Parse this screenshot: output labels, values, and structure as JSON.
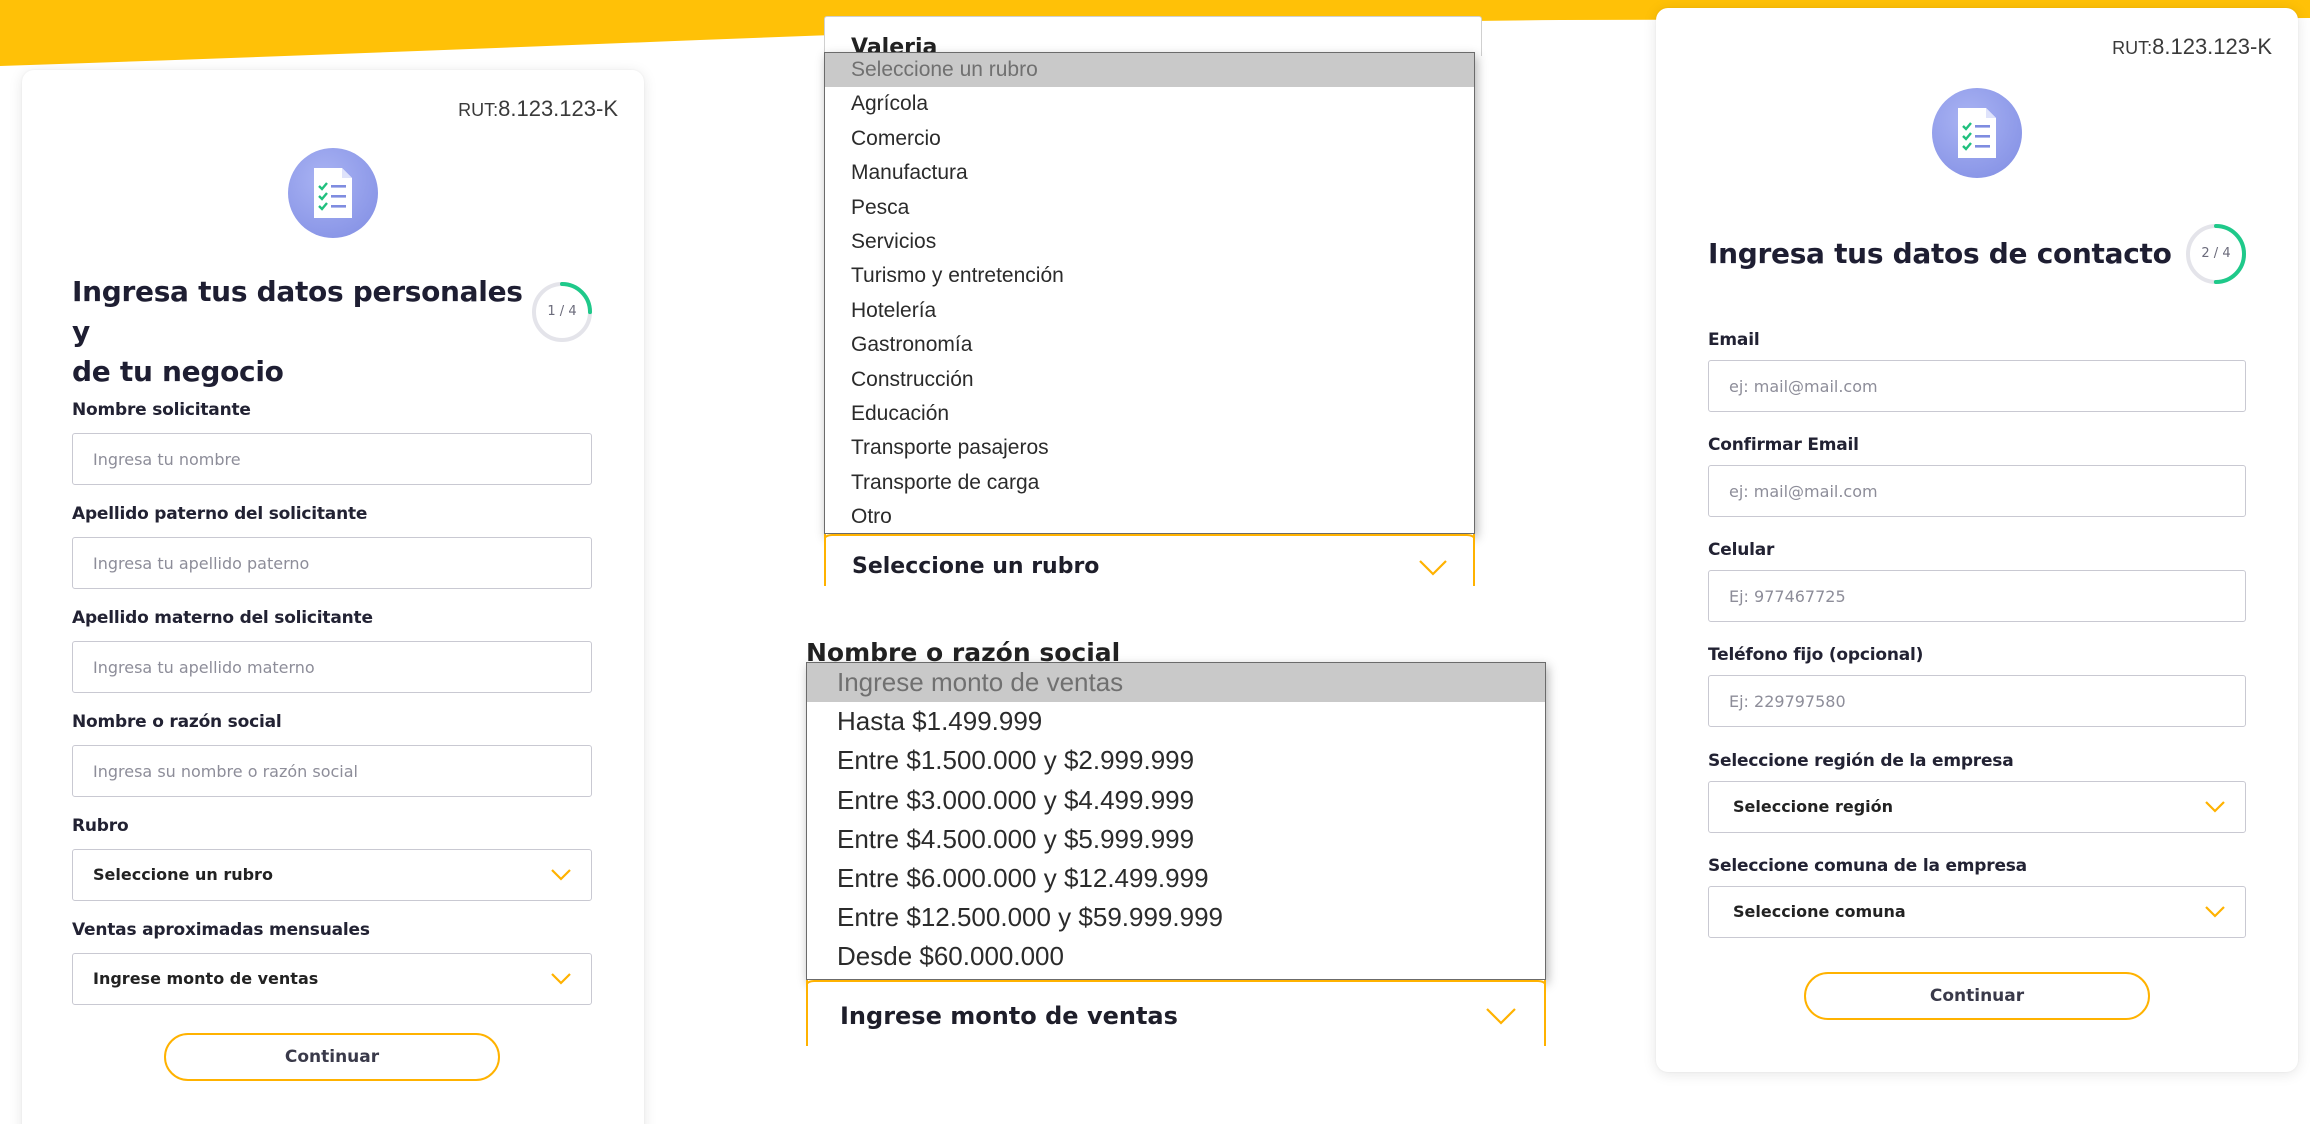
{
  "colors": {
    "accent": "#ffb200",
    "progress": "#1fc98a",
    "badge": "#8c98e8"
  },
  "rut": {
    "label": "RUT:",
    "value": "8.123.123-K"
  },
  "card1": {
    "title_line1": "Ingresa tus datos personales y",
    "title_line2": "de tu negocio",
    "step": "1 / 4",
    "step_progress": 0.25,
    "fields": {
      "nombre": {
        "label": "Nombre solicitante",
        "placeholder": "Ingresa tu nombre"
      },
      "paterno": {
        "label": "Apellido paterno del solicitante",
        "placeholder": "Ingresa tu apellido paterno"
      },
      "materno": {
        "label": "Apellido materno del solicitante",
        "placeholder": "Ingresa tu apellido materno"
      },
      "razon": {
        "label": "Nombre o razón social",
        "placeholder": "Ingresa su nombre o razón social"
      },
      "rubro": {
        "label": "Rubro",
        "value": "Seleccione un rubro"
      },
      "ventas": {
        "label": "Ventas aproximadas mensuales",
        "value": "Ingrese monto de ventas"
      }
    },
    "continue": "Continuar"
  },
  "rubro_dropdown": {
    "peek_value": "Valeria",
    "selected_value": "Seleccione un rubro",
    "options": [
      "Seleccione un rubro",
      "Agrícola",
      "Comercio",
      "Manufactura",
      "Pesca",
      "Servicios",
      "Turismo y entretención",
      "Hotelería",
      "Gastronomía",
      "Construcción",
      "Educación",
      "Transporte pasajeros",
      "Transporte de carga",
      "Otro"
    ]
  },
  "ventas_dropdown": {
    "peek_label": "Nombre o razón social",
    "selected_value": "Ingrese monto de ventas",
    "options": [
      "Ingrese monto de ventas",
      "Hasta $1.499.999",
      "Entre $1.500.000 y $2.999.999",
      "Entre $3.000.000 y $4.499.999",
      "Entre $4.500.000 y $5.999.999",
      "Entre $6.000.000 y $12.499.999",
      "Entre $12.500.000 y $59.999.999",
      "Desde $60.000.000"
    ]
  },
  "card2": {
    "title": "Ingresa tus datos de contacto",
    "step": "2 / 4",
    "step_progress": 0.5,
    "fields": {
      "email": {
        "label": "Email",
        "placeholder": "ej: mail@mail.com"
      },
      "confirm_email": {
        "label": "Confirmar Email",
        "placeholder": "ej: mail@mail.com"
      },
      "celular": {
        "label": "Celular",
        "placeholder": "Ej: 977467725"
      },
      "fijo": {
        "label": "Teléfono fijo (opcional)",
        "placeholder": "Ej: 229797580"
      },
      "region": {
        "label": "Seleccione región de la empresa",
        "value": "Seleccione región"
      },
      "comuna": {
        "label": "Seleccione comuna de la empresa",
        "value": "Seleccione comuna"
      }
    },
    "continue": "Continuar"
  }
}
